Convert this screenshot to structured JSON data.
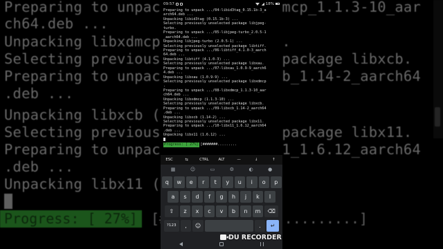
{
  "background": {
    "lines": [
      "Preparing to unpack .../02-libxdmcp_1.1.3-10_aar",
      "ch64.deb ...",
      "Unpacking libxdmcp (1.1.3-10) ...",
      "Selecting previously unselected package libxcb.",
      "Preparing to unpack .../09-libxcb_1.14-2_aarch64",
      ".deb ...",
      "Unpacking libxcb (1.14-2) ...",
      "Selecting previously unselected package libx11.",
      "Preparing to unpack .../10-libx11_1.6.12_aarch64",
      ".deb ...",
      "Unpacking libx11 (1.6.12) ..."
    ],
    "progress_label": "Progress: [ 27%]",
    "progress_tail": "[#######.................]",
    "progress_percent": 27
  },
  "status_bar": {
    "time": "09:57",
    "battery": "18%"
  },
  "terminal": {
    "lines": [
      "Preparing to unpack .../04-libid3tag_0.15.1b-3_a",
      "arch64.deb ...",
      "Unpacking libid3tag (0.15.1b-3) ...",
      "Selecting previously unselected package libjpeg-",
      "turbo.",
      "Preparing to unpack .../05-libjpeg-turbo_2.0.5-1",
      "_aarch64.deb ...",
      "Unpacking libjpeg-turbo (2.0.5-1) ...",
      "Selecting previously unselected package libtiff.",
      "Preparing to unpack .../06-libtiff_4.1.0-3_aarch",
      "64.deb ...",
      "Unpacking libtiff (4.1.0-3) ...",
      "Selecting previously unselected package libxau.",
      "Preparing to unpack .../07-libxau_1.0.9-9_aarch6",
      "4.deb ...",
      "Unpacking libxau (1.0.9-9) ...",
      "Selecting previously unselected package libxdmcp",
      ".",
      "Preparing to unpack .../08-libxdmcp_1.1.3-10_aar",
      "ch64.deb ...",
      "Unpacking libxdmcp (1.1.3-10) ...",
      "Selecting previously unselected package libxcb.",
      "Preparing to unpack .../09-libxcb_1.14-2_aarch64",
      ".deb ...",
      "Unpacking libxcb (1.14-2) ...",
      "Selecting previously unselected package libx11.",
      "Preparing to unpack .../10-libx11_1.6.12_aarch64",
      ".deb ...",
      "Unpacking libx11 (1.6.12) ..."
    ],
    "progress_label": "Progress: [ 27%]",
    "progress_tail": "[#######.........",
    "progress_percent": 27
  },
  "extra_keys": [
    "ESC",
    "⇆",
    "CTRL",
    "ALT",
    "—",
    "↓",
    "↑"
  ],
  "keyboard": {
    "toolbar_icons": [
      "grid-icon",
      "sticker-icon",
      "gif-icon",
      "settings-icon",
      "palette-icon",
      "mic-icon"
    ],
    "row1": [
      "q",
      "w",
      "e",
      "r",
      "t",
      "y",
      "u",
      "i",
      "o",
      "p"
    ],
    "row2": [
      "a",
      "s",
      "d",
      "f",
      "g",
      "h",
      "j",
      "k",
      "l"
    ],
    "row3": [
      "⇧",
      "z",
      "x",
      "c",
      "v",
      "b",
      "n",
      "m",
      "⌫"
    ],
    "row4": {
      "symbols": "?123",
      "comma": ",",
      "emoji": "☺",
      "period": ".",
      "enter": "↵"
    }
  },
  "recorder": {
    "label": "DU RECORDER"
  },
  "colors": {
    "progress_green": "#3da33d",
    "keyboard_bg": "#202124",
    "key_bg": "#3c4043",
    "enter_key": "#8ab4f8"
  }
}
